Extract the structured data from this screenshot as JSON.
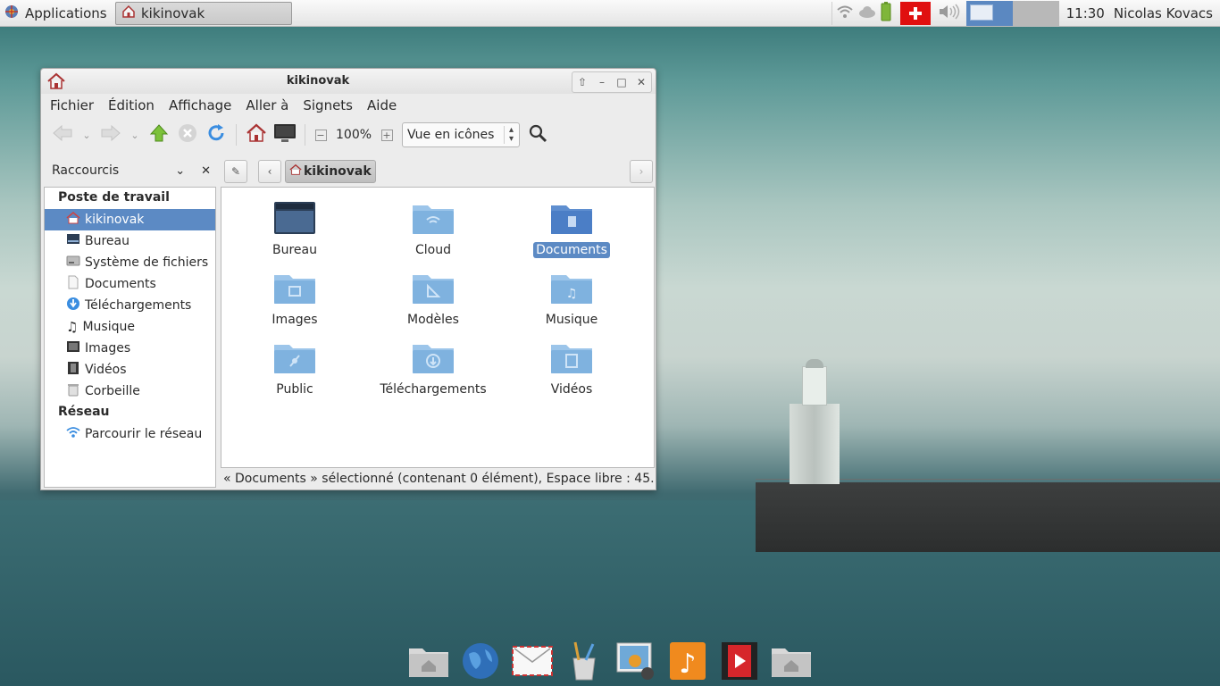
{
  "top_panel": {
    "applications_label": "Applications",
    "task_label": "kikinovak",
    "clock": "11:30",
    "user": "Nicolas Kovacs"
  },
  "window": {
    "title": "kikinovak",
    "menu": [
      "Fichier",
      "Édition",
      "Affichage",
      "Aller à",
      "Signets",
      "Aide"
    ],
    "zoom": "100%",
    "view_mode": "Vue en icônes",
    "sidebar_title": "Raccourcis",
    "sidebar": {
      "group1": "Poste de travail",
      "items": [
        "kikinovak",
        "Bureau",
        "Système de fichiers",
        "Documents",
        "Téléchargements",
        "Musique",
        "Images",
        "Vidéos",
        "Corbeille"
      ],
      "group2": "Réseau",
      "network_item": "Parcourir le réseau"
    },
    "path_crumb": "kikinovak",
    "files": [
      "Bureau",
      "Cloud",
      "Documents",
      "Images",
      "Modèles",
      "Musique",
      "Public",
      "Téléchargements",
      "Vidéos"
    ],
    "selected_file": "Documents",
    "status": "« Documents » sélectionné (contenant 0 élément), Espace libre : 45..."
  },
  "colors": {
    "selection": "#5c8ac4",
    "folder": "#7fb2df",
    "accent_red": "#e01010"
  }
}
